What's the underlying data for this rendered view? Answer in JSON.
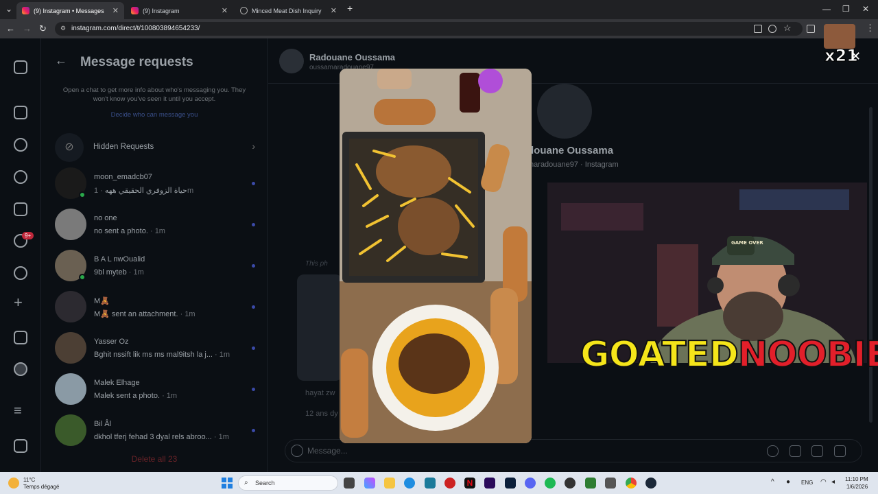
{
  "browser": {
    "tabs": [
      {
        "label": "(9) Instagram • Messages",
        "active": true
      },
      {
        "label": "(9) Instagram",
        "active": false
      },
      {
        "label": "Minced Meat Dish Inquiry",
        "active": false
      }
    ],
    "url": "instagram.com/direct/t/100803894654233/"
  },
  "requests": {
    "title": "Message requests",
    "info": "Open a chat to get more info about who's messaging you. They won't know you've seen it until you accept.",
    "link": "Decide who can message you",
    "hidden_label": "Hidden Requests",
    "notification_badge": "9+",
    "conversations": [
      {
        "name": "moon_emadcb07",
        "preview": "حياة الزوفري الحقيقي ههه",
        "time": "1m",
        "online": true
      },
      {
        "name": "no one",
        "preview": "no sent a photo.",
        "time": "1m",
        "online": false
      },
      {
        "name": "B A L nwOualid",
        "preview": "9bl myteb",
        "time": "1m",
        "online": true
      },
      {
        "name": "M🧸",
        "preview": "M🧸 sent an attachment.",
        "time": "1m",
        "online": false
      },
      {
        "name": "Yasser Oz",
        "preview": "Bghit nssift lik ms ms mal9itsh la j...",
        "time": "1m",
        "online": false
      },
      {
        "name": "Malek Elhage",
        "preview": "Malek sent a photo.",
        "time": "1m",
        "online": false
      },
      {
        "name": "Bil Âl",
        "preview": "dkhol tferj fehad 3 dyal rels abroo...",
        "time": "1m",
        "online": false
      }
    ],
    "delete_all": "Delete all 23"
  },
  "chat": {
    "name": "Radouane Oussama",
    "handle": "oussamaradouane97",
    "profile_name": "douane Oussama",
    "profile_handle": "maradouane97 · Instagram",
    "photo_label": "This ph",
    "messages": [
      "hayat zw",
      "12 ans dy"
    ],
    "composer_placeholder": "Message..."
  },
  "overlay": {
    "brand_part1": "GOATED",
    "brand_part2": "NOOBIE",
    "multiplier": "x21",
    "cap_text": "GAME OVER"
  },
  "taskbar": {
    "temperature": "11°C",
    "weather": "Temps dégagé",
    "search_placeholder": "Search",
    "language": "ENG",
    "time": "11:10 PM",
    "date": "1/6/2026"
  }
}
